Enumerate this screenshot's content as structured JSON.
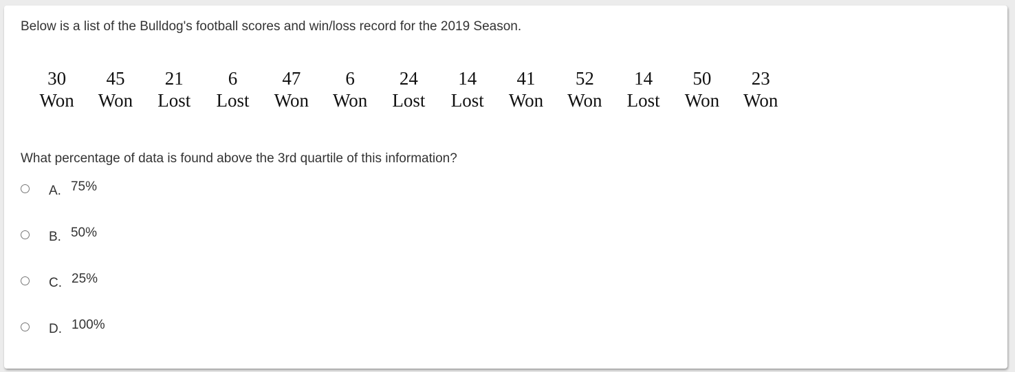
{
  "intro": "Below is a list of the Bulldog's football scores and win/loss record for the 2019 Season.",
  "games": [
    {
      "score": "30",
      "result": "Won"
    },
    {
      "score": "45",
      "result": "Won"
    },
    {
      "score": "21",
      "result": "Lost"
    },
    {
      "score": "6",
      "result": "Lost"
    },
    {
      "score": "47",
      "result": "Won"
    },
    {
      "score": "6",
      "result": "Won"
    },
    {
      "score": "24",
      "result": "Lost"
    },
    {
      "score": "14",
      "result": "Lost"
    },
    {
      "score": "41",
      "result": "Won"
    },
    {
      "score": "52",
      "result": "Won"
    },
    {
      "score": "14",
      "result": "Lost"
    },
    {
      "score": "50",
      "result": "Won"
    },
    {
      "score": "23",
      "result": "Won"
    }
  ],
  "question": "What percentage of data is found above the 3rd quartile of this information?",
  "options": [
    {
      "letter": "A.",
      "text": "75%",
      "selected": false
    },
    {
      "letter": "B.",
      "text": "50%",
      "selected": false
    },
    {
      "letter": "C.",
      "text": "25%",
      "selected": false
    },
    {
      "letter": "D.",
      "text": "100%",
      "selected": false
    }
  ]
}
